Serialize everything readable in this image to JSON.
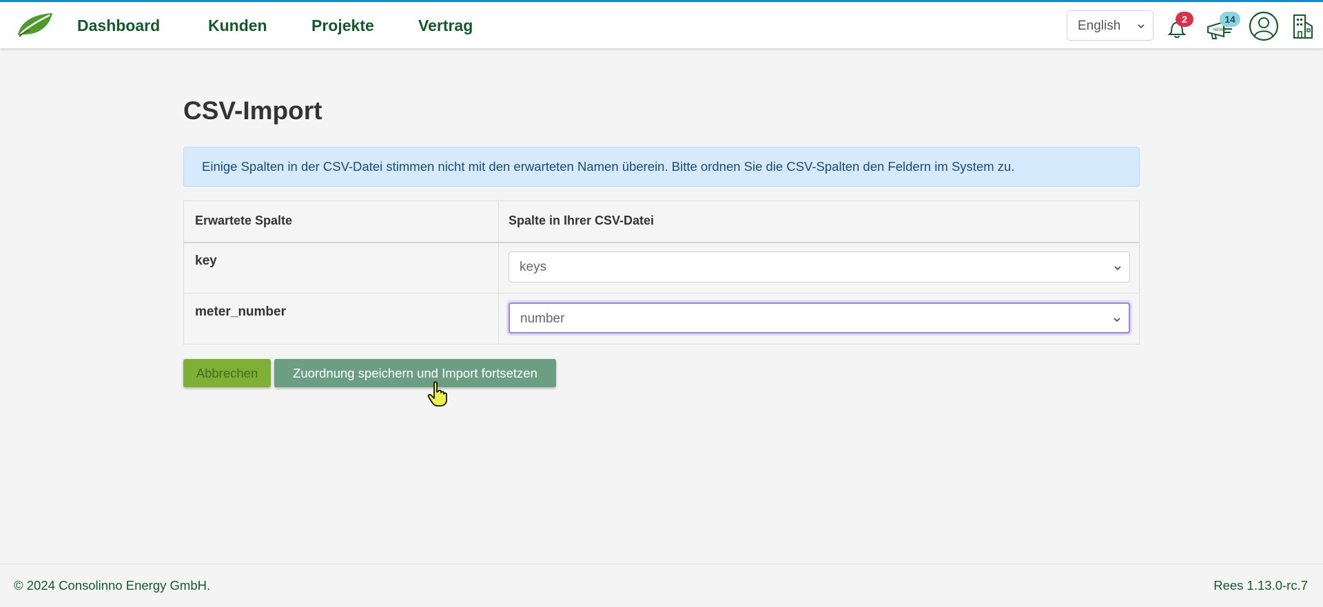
{
  "nav": {
    "links": [
      "Dashboard",
      "Kunden",
      "Projekte",
      "Vertrag"
    ],
    "language": "English",
    "notifications_count": "2",
    "news_count": "14",
    "news_label": "NEWS"
  },
  "page": {
    "title": "CSV-Import",
    "alert": "Einige Spalten in der CSV-Datei stimmen nicht mit den erwarteten Namen überein. Bitte ordnen Sie die CSV-Spalten den Feldern im System zu."
  },
  "table": {
    "headers": [
      "Erwartete Spalte",
      "Spalte in Ihrer CSV-Datei"
    ],
    "rows": [
      {
        "expected": "key",
        "csv_column": "keys"
      },
      {
        "expected": "meter_number",
        "csv_column": "number"
      }
    ]
  },
  "buttons": {
    "cancel": "Abbrechen",
    "save": "Zuordnung speichern und Import fortsetzen"
  },
  "footer": {
    "copyright": "© 2024 Consolinno Energy GmbH.",
    "version": "Rees 1.13.0-rc.7"
  },
  "colors": {
    "brand_green": "#14592c",
    "cancel_button": "#7faf35",
    "save_button": "#6b9e83",
    "alert_bg": "#d6eafd",
    "notification_badge": "#d9334a",
    "news_badge": "#8fd3e0"
  },
  "icons": {
    "logo": "leaf-logo-icon",
    "notifications": "bell-icon",
    "news": "megaphone-icon",
    "user": "user-avatar-icon",
    "building": "building-icon"
  }
}
